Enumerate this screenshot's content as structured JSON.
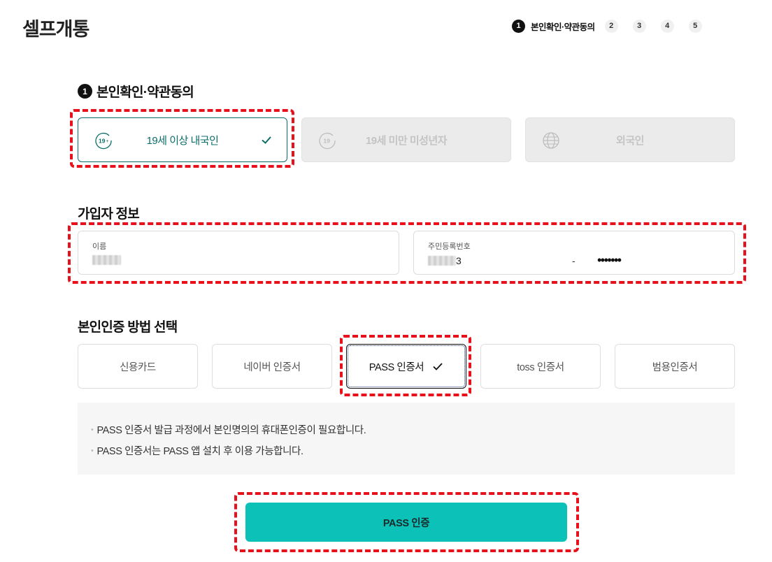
{
  "header": {
    "title": "셀프개통",
    "steps": [
      {
        "number": "1",
        "label": "본인확인·약관동의",
        "active": true
      },
      {
        "number": "2"
      },
      {
        "number": "3"
      },
      {
        "number": "4"
      },
      {
        "number": "5"
      }
    ]
  },
  "section1": {
    "number": "1",
    "title": "본인확인·약관동의",
    "customer_types": [
      {
        "label": "19세 이상 내국인",
        "icon": "age-19-plus-icon",
        "selected": true
      },
      {
        "label": "19세 미만 미성년자",
        "icon": "age-19-icon",
        "selected": false
      },
      {
        "label": "외국인",
        "icon": "globe-icon",
        "selected": false
      }
    ]
  },
  "subscriber": {
    "title": "가입자 정보",
    "name_label": "이름",
    "rrn_label": "주민등록번호",
    "rrn_front_visible_suffix": "3",
    "rrn_separator": "-",
    "rrn_back_masked": "•••••••"
  },
  "auth": {
    "title": "본인인증 방법 선택",
    "methods": [
      "신용카드",
      "네이버 인증서",
      "PASS 인증서",
      "toss 인증서",
      "범용인증서"
    ],
    "selected_index": 2,
    "notices": [
      "PASS 인증서 발급 과정에서 본인명의의 휴대폰인증이 필요합니다.",
      "PASS 인증서는 PASS 앱 설치 후 이용 가능합니다."
    ],
    "submit_label": "PASS 인증"
  },
  "colors": {
    "accent_teal": "#0b6e6a",
    "cta_teal": "#0cc1b8",
    "highlight_red": "#e8111b"
  }
}
